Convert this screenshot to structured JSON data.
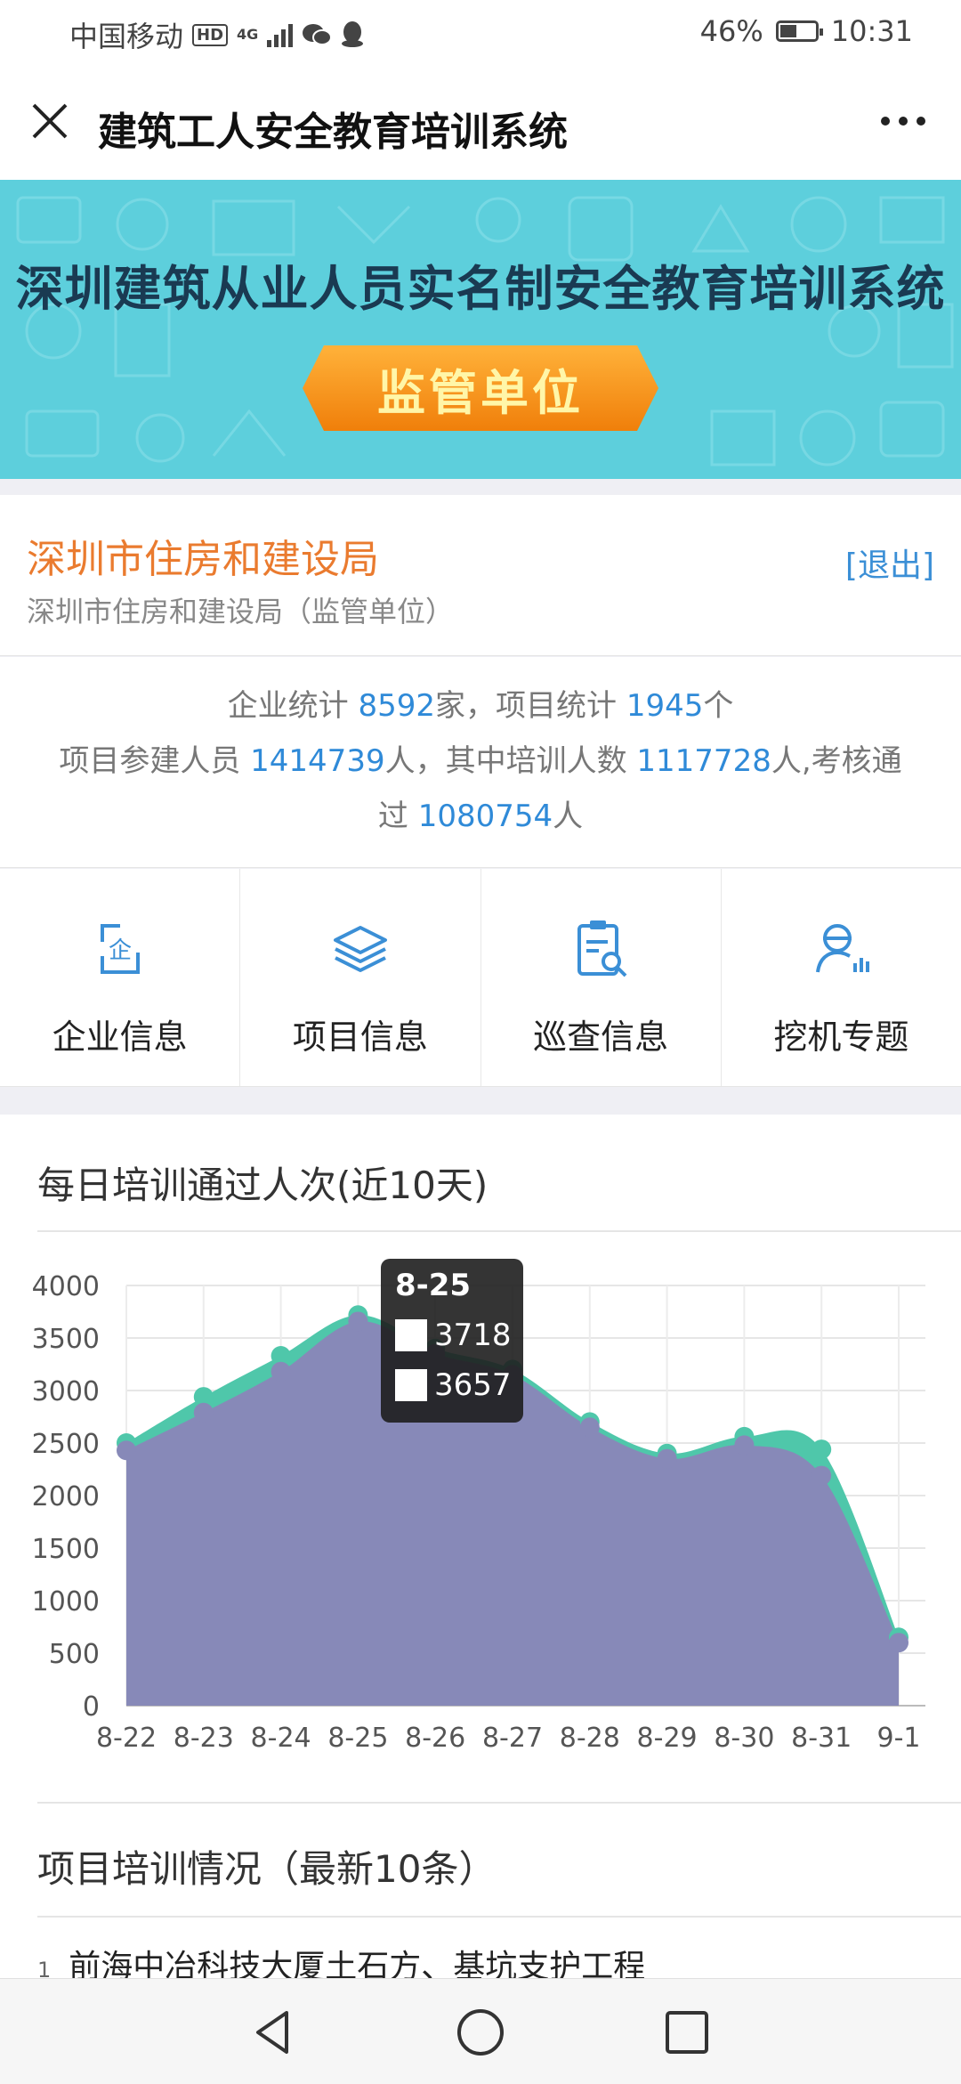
{
  "status_bar": {
    "carrier": "中国移动",
    "hd_badge": "HD",
    "network": "4G",
    "battery_percent": "46%",
    "battery_level": 0.46,
    "time": "10:31",
    "icons": [
      "signal-icon",
      "wechat-icon",
      "qq-icon",
      "battery-icon"
    ]
  },
  "title_bar": {
    "title": "建筑工人安全教育培训系统",
    "close_icon": "close-icon",
    "more_icon": "more-icon"
  },
  "banner": {
    "title": "深圳建筑从业人员实名制安全教育培训系统",
    "ribbon": "监管单位"
  },
  "org": {
    "name": "深圳市住房和建设局",
    "sub": "深圳市住房和建设局（监管单位）",
    "logout": "[退出]"
  },
  "stats": {
    "enterprise_label": "企业统计",
    "enterprise_count": "8592",
    "enterprise_unit": "家，项目统计",
    "project_count": "1945",
    "project_unit": "个",
    "participants_label": "项目参建人员",
    "participants": "1414739",
    "trained_label": "人，其中培训人数",
    "trained": "1117728",
    "passed_label": "人,考核通",
    "passed_label2": "过",
    "passed": "1080754",
    "person_unit": "人"
  },
  "menu": [
    {
      "label": "企业信息",
      "icon": "enterprise-icon"
    },
    {
      "label": "项目信息",
      "icon": "layers-icon"
    },
    {
      "label": "巡查信息",
      "icon": "clipboard-search-icon"
    },
    {
      "label": "挖机专题",
      "icon": "excavator-user-icon"
    }
  ],
  "chart_section": {
    "title": "每日培训通过人次(近10天)"
  },
  "chart_data": {
    "type": "area",
    "x": [
      "8-22",
      "8-23",
      "8-24",
      "8-25",
      "8-26",
      "8-27",
      "8-28",
      "8-29",
      "8-30",
      "8-31",
      "9-1"
    ],
    "ylim": [
      0,
      4000
    ],
    "yticks": [
      "0",
      "500",
      "1000",
      "1500",
      "2000",
      "2500",
      "3000",
      "3500",
      "4000"
    ],
    "grid": true,
    "series": [
      {
        "values": [
          2500,
          2940,
          3330,
          3718,
          3400,
          3200,
          2700,
          2400,
          2560,
          2440,
          650
        ],
        "color": "#4fc7aa"
      },
      {
        "values": [
          2430,
          2790,
          3180,
          3657,
          3350,
          3150,
          2650,
          2350,
          2480,
          2190,
          600
        ],
        "color": "#8789b8"
      }
    ],
    "tooltip": {
      "label": "8-25",
      "values": [
        "3718",
        "3657"
      ]
    }
  },
  "list_section": {
    "title": "项目培训情况（最新10条）",
    "first_index": "1",
    "first_item": "前海中冶科技大厦土石方、基坑支护工程"
  },
  "nav_bar": {
    "buttons": [
      "back-icon",
      "home-icon",
      "recents-icon"
    ]
  }
}
